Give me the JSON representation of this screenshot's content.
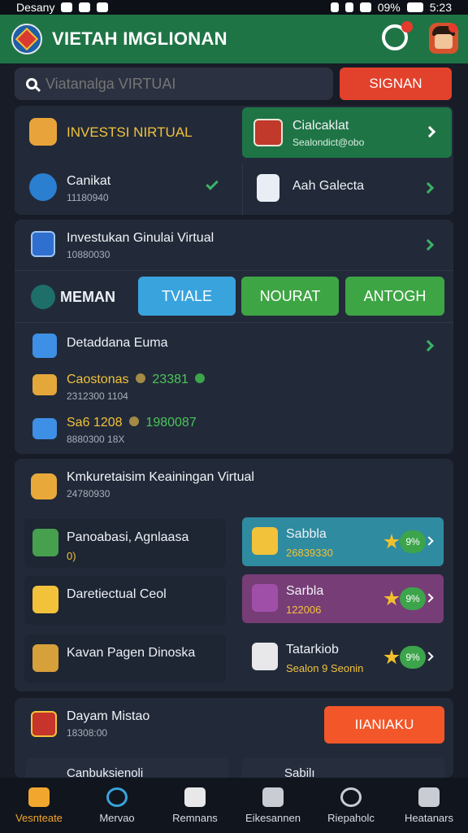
{
  "status_bar": {
    "left_text": "Desany",
    "battery": "09%",
    "time": "5:23"
  },
  "header": {
    "title": "VIETAH IMGLIONAN"
  },
  "search": {
    "placeholder": "Viatanalga VIRTUAI"
  },
  "signin_button": "SIGNAN",
  "section1": {
    "item1": {
      "label": "INVESTSI NIRTUAL"
    },
    "featured": {
      "title": "Cialcaklat",
      "subtitle": "Sealondict@obo"
    },
    "item2": {
      "title": "Canikat",
      "subtitle": "11180940"
    },
    "item3": {
      "title": "Aah Galecta"
    }
  },
  "section2": {
    "header": {
      "title": "Investukan Ginulai Virtual",
      "subtitle": "10880030"
    },
    "menu_label": "MEMAN",
    "buttons": [
      "TVIALE",
      "NOURAT",
      "ANTOGH"
    ],
    "button_colors": [
      "#39a3dd",
      "#3ea544",
      "#3ea544"
    ],
    "row1": {
      "title": "Detaddana Euma"
    },
    "row2": {
      "title": "Caostonas",
      "value": "23381",
      "subtitle": "2312300 1104"
    },
    "row3": {
      "title": "Sa6 1208",
      "value": "1980087",
      "subtitle": "8880300 18X"
    }
  },
  "section3": {
    "header": {
      "title": "Kmkuretaisim Keainingan Virtual",
      "subtitle": "24780930"
    },
    "tiles_left": [
      {
        "title": "Panoabasi, Agnlaasa",
        "subtitle": "0)"
      },
      {
        "title": "Daretiectual Ceol",
        "subtitle": ""
      },
      {
        "title": "Kavan Pagen Dinoska",
        "subtitle": ""
      }
    ],
    "tiles_right": [
      {
        "title": "Sabbla",
        "subtitle": "26839330",
        "badge": "9%",
        "bg": "#2f8ba0"
      },
      {
        "title": "Sarbla",
        "subtitle": "122006",
        "badge": "9%",
        "bg": "#773d77"
      },
      {
        "title": "Tatarkiob",
        "subtitle": "Sealon 9 Seonin",
        "badge": "9%",
        "bg": "#222a39"
      }
    ]
  },
  "section4": {
    "title": "Dayam Mistao",
    "subtitle": "18308:00",
    "button": "IIANIAKU",
    "partial_left": "Canbuksienoli",
    "partial_right": "Sabilı"
  },
  "bottom_nav": [
    {
      "label": "Vesnteate",
      "icon": "home-icon"
    },
    {
      "label": "Mervao",
      "icon": "compass-icon"
    },
    {
      "label": "Remnans",
      "icon": "portrait-icon"
    },
    {
      "label": "Eikesannen",
      "icon": "people-icon"
    },
    {
      "label": "Riepaholc",
      "icon": "search-icon"
    },
    {
      "label": "Heatanars",
      "icon": "group-icon"
    }
  ]
}
